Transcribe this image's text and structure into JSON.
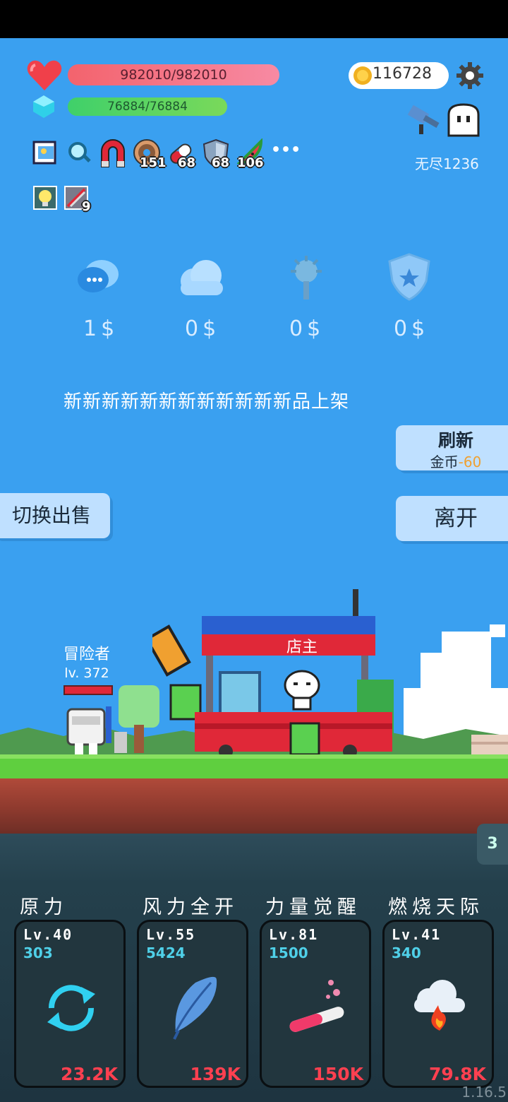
{
  "status": {
    "hp": "982010/982010",
    "mp": "76884/76884",
    "coins": "116728",
    "endless": "无尽1236"
  },
  "buffs": {
    "row1": [
      {
        "icon": "photo-card-icon"
      },
      {
        "icon": "magnifier-icon"
      },
      {
        "icon": "magnet-icon"
      },
      {
        "icon": "donut-icon",
        "count": "151"
      },
      {
        "icon": "pill-icon",
        "count": "68"
      },
      {
        "icon": "shield-icon",
        "count": "68"
      },
      {
        "icon": "watermelon-icon",
        "count": "106"
      }
    ],
    "more": "•••",
    "row2": [
      {
        "icon": "lightbulb-icon"
      },
      {
        "icon": "crystal-card-icon",
        "count": "9"
      }
    ]
  },
  "shop": {
    "items": [
      {
        "icon": "chat-bubble-icon",
        "price": "1$"
      },
      {
        "icon": "cloud-icon",
        "price": "0$"
      },
      {
        "icon": "spiked-mace-icon",
        "price": "0$"
      },
      {
        "icon": "star-shield-icon",
        "price": "0$"
      }
    ],
    "banner": "新新新新新新新新新新新新品上架",
    "refresh": {
      "title": "刷新",
      "cost_label": "金币",
      "cost_value": "-60"
    },
    "leave": "离开",
    "switch_sell": "切换出售",
    "shopkeeper": "店主"
  },
  "player": {
    "name": "冒险者",
    "level": "lv. 372"
  },
  "side_tab": "3",
  "skills": [
    {
      "name": "原力",
      "lv": "Lv.40",
      "value": "303",
      "cost": "23.2K",
      "icon": "refresh-cycle-icon"
    },
    {
      "name": "风力全开",
      "lv": "Lv.55",
      "value": "5424",
      "cost": "139K",
      "icon": "feather-icon"
    },
    {
      "name": "力量觉醒",
      "lv": "Lv.81",
      "value": "1500",
      "cost": "150K",
      "icon": "potion-tube-icon"
    },
    {
      "name": "燃烧天际",
      "lv": "Lv.41",
      "value": "340",
      "cost": "79.8K",
      "icon": "fire-cloud-icon"
    }
  ],
  "version": "1.16.5",
  "colors": {
    "sky": "#3aa0f0",
    "hp": "#f3636d",
    "mp": "#3fd06a",
    "cost": "#ff4050",
    "skill_value": "#4fd0e8"
  }
}
